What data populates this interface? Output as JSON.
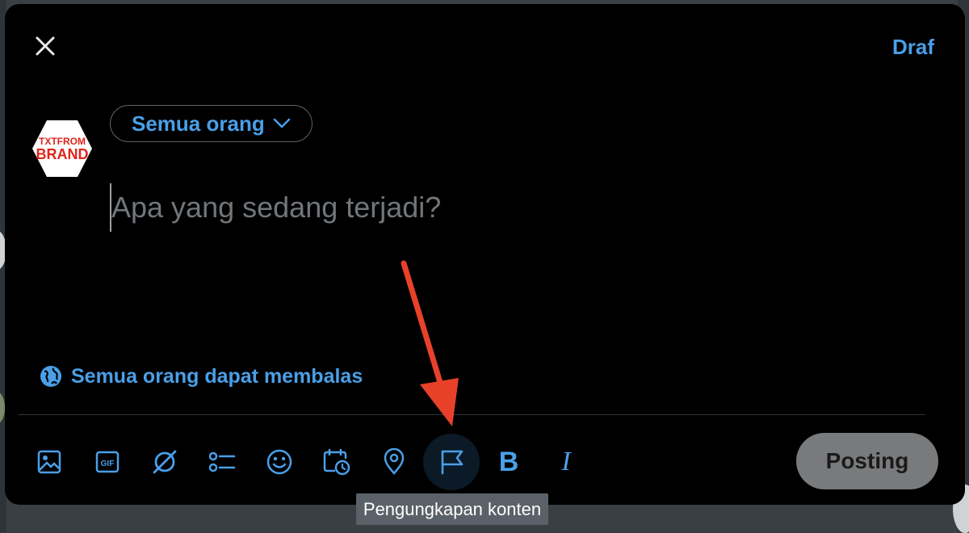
{
  "header": {
    "close_icon": "close-icon",
    "drafts_label": "Draf"
  },
  "avatar": {
    "line1": "TXTFROM",
    "line2": "BRAND",
    "color": "#e0241b"
  },
  "audience": {
    "label": "Semua orang",
    "icon": "chevron-down-icon"
  },
  "compose": {
    "placeholder": "Apa yang sedang terjadi?",
    "value": ""
  },
  "reply_setting": {
    "label": "Semua orang dapat membalas",
    "icon": "globe-icon"
  },
  "toolbar": {
    "items": [
      {
        "name": "media",
        "icon": "image-icon"
      },
      {
        "name": "gif",
        "icon": "gif-icon",
        "text": "GIF"
      },
      {
        "name": "grok",
        "icon": "grok-icon"
      },
      {
        "name": "poll",
        "icon": "poll-icon"
      },
      {
        "name": "emoji",
        "icon": "emoji-icon"
      },
      {
        "name": "schedule",
        "icon": "schedule-icon"
      },
      {
        "name": "location",
        "icon": "location-icon"
      },
      {
        "name": "content-disclosure",
        "icon": "flag-icon",
        "active": true
      },
      {
        "name": "bold",
        "icon": "bold-icon",
        "text": "B"
      },
      {
        "name": "italic",
        "icon": "italic-icon",
        "text": "I"
      }
    ],
    "post_label": "Posting"
  },
  "tooltip": {
    "text": "Pengungkapan konten"
  },
  "colors": {
    "accent": "#4a9fe8",
    "background": "#000000",
    "annotation_arrow": "#e8412a"
  }
}
